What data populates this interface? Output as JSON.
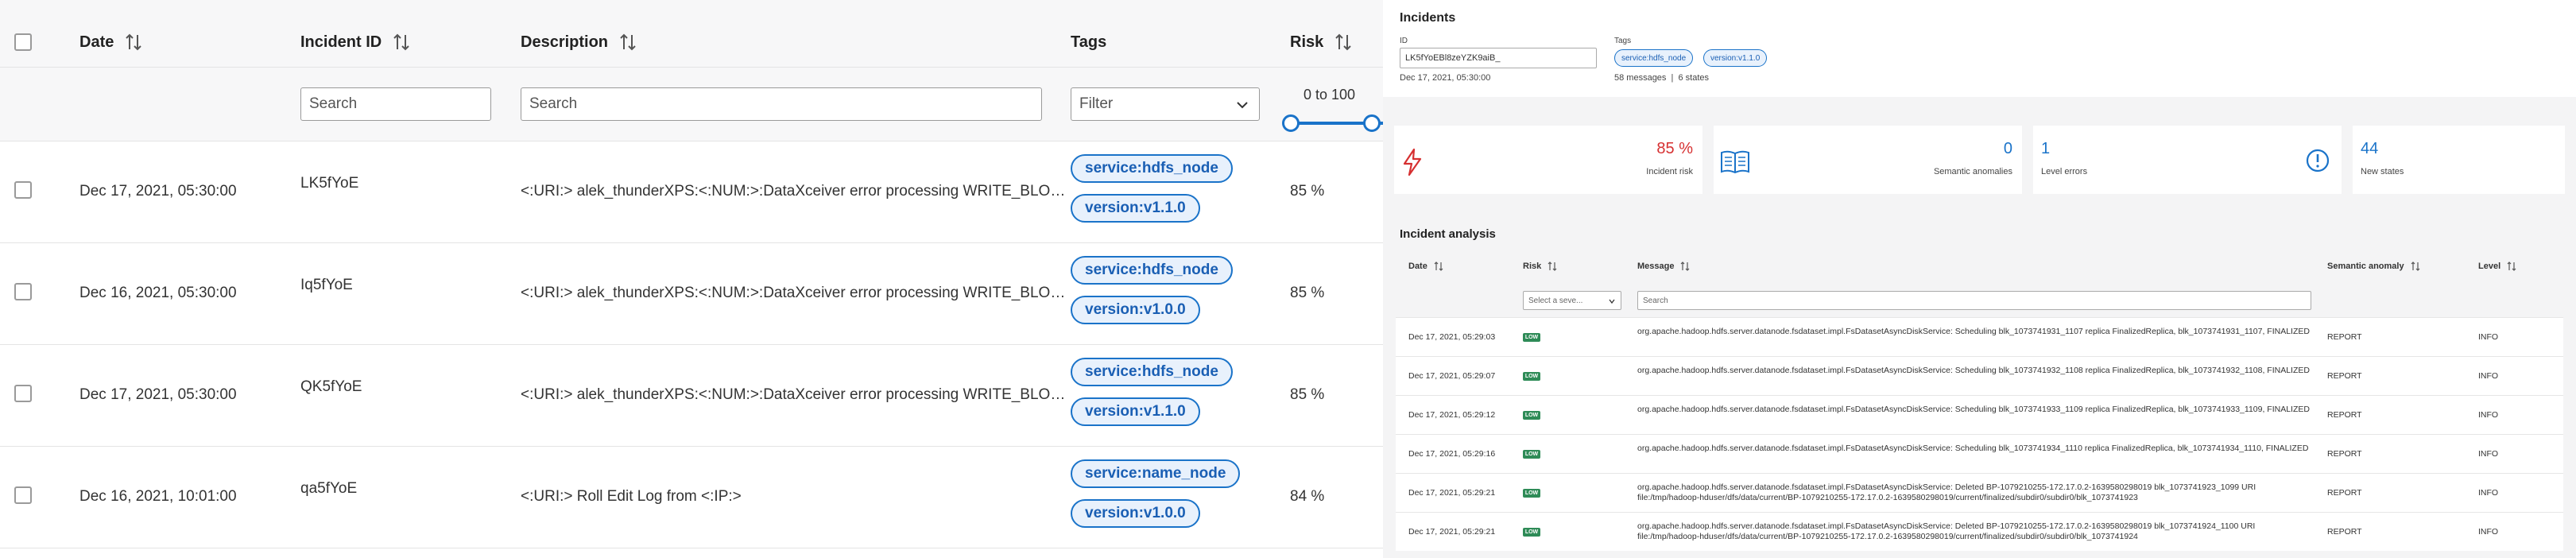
{
  "incidents_table": {
    "columns": {
      "date": "Date",
      "incident_id": "Incident ID",
      "description": "Description",
      "tags": "Tags",
      "risk": "Risk"
    },
    "filters": {
      "incident_id_placeholder": "Search",
      "description_placeholder": "Search",
      "tags_placeholder": "Filter",
      "risk_range_label": "0 to 100",
      "risk_range": [
        0,
        100
      ]
    },
    "rows": [
      {
        "date": "Dec 17, 2021, 05:30:00",
        "id": "LK5fYoE",
        "description": "<:URI:> alek_thunderXPS:<:NUM:>:DataXceiver error processing WRITE_BLO…",
        "tags": [
          "service:hdfs_node",
          "version:v1.1.0"
        ],
        "risk": "85 %"
      },
      {
        "date": "Dec 16, 2021, 05:30:00",
        "id": "Iq5fYoE",
        "description": "<:URI:> alek_thunderXPS:<:NUM:>:DataXceiver error processing WRITE_BLO…",
        "tags": [
          "service:hdfs_node",
          "version:v1.0.0"
        ],
        "risk": "85 %"
      },
      {
        "date": "Dec 17, 2021, 05:30:00",
        "id": "QK5fYoE",
        "description": "<:URI:> alek_thunderXPS:<:NUM:>:DataXceiver error processing WRITE_BLO…",
        "tags": [
          "service:hdfs_node",
          "version:v1.1.0"
        ],
        "risk": "85 %"
      },
      {
        "date": "Dec 16, 2021, 10:01:00",
        "id": "qa5fYoE",
        "description": "<:URI:> Roll Edit Log from <:IP:>",
        "tags": [
          "service:name_node",
          "version:v1.0.0"
        ],
        "risk": "84 %"
      }
    ]
  },
  "incident_detail": {
    "title": "Incidents",
    "id_label": "ID",
    "id_value": "LK5fYoEBl8zeYZK9aiB_",
    "date": "Dec 17, 2021, 05:30:00",
    "tags_label": "Tags",
    "tags": [
      "service:hdfs_node",
      "version:v1.1.0"
    ],
    "summary": "58 messages  |  6 states"
  },
  "stats": {
    "incident_risk": {
      "value": "85 %",
      "label": "Incident risk",
      "color": "#d63031"
    },
    "semantic_anomalies": {
      "value": "0",
      "label": "Semantic anomalies",
      "color": "#1a73c9"
    },
    "level_errors": {
      "value": "1",
      "label": "Level errors",
      "color": "#1a73c9"
    },
    "new_states": {
      "value": "44",
      "label": "New states",
      "color": "#1a73c9"
    }
  },
  "analysis": {
    "title": "Incident analysis",
    "columns": {
      "date": "Date",
      "risk": "Risk",
      "message": "Message",
      "semantic_anomaly": "Semantic anomaly",
      "level": "Level"
    },
    "risk_select_placeholder": "Select a seve...",
    "message_search_placeholder": "Search",
    "rows": [
      {
        "date": "Dec 17, 2021, 05:29:03",
        "risk": "LOW",
        "message": "org.apache.hadoop.hdfs.server.datanode.fsdataset.impl.FsDatasetAsyncDiskService: Scheduling blk_1073741931_1107 replica FinalizedReplica, blk_1073741931_1107, FINALIZED",
        "anomaly": "REPORT",
        "level": "INFO"
      },
      {
        "date": "Dec 17, 2021, 05:29:07",
        "risk": "LOW",
        "message": "org.apache.hadoop.hdfs.server.datanode.fsdataset.impl.FsDatasetAsyncDiskService: Scheduling blk_1073741932_1108 replica FinalizedReplica, blk_1073741932_1108, FINALIZED",
        "anomaly": "REPORT",
        "level": "INFO"
      },
      {
        "date": "Dec 17, 2021, 05:29:12",
        "risk": "LOW",
        "message": "org.apache.hadoop.hdfs.server.datanode.fsdataset.impl.FsDatasetAsyncDiskService: Scheduling blk_1073741933_1109 replica FinalizedReplica, blk_1073741933_1109, FINALIZED",
        "anomaly": "REPORT",
        "level": "INFO"
      },
      {
        "date": "Dec 17, 2021, 05:29:16",
        "risk": "LOW",
        "message": "org.apache.hadoop.hdfs.server.datanode.fsdataset.impl.FsDatasetAsyncDiskService: Scheduling blk_1073741934_1110 replica FinalizedReplica, blk_1073741934_1110, FINALIZED",
        "anomaly": "REPORT",
        "level": "INFO"
      },
      {
        "date": "Dec 17, 2021, 05:29:21",
        "risk": "LOW",
        "message": "org.apache.hadoop.hdfs.server.datanode.fsdataset.impl.FsDatasetAsyncDiskService: Deleted BP-1079210255-172.17.0.2-1639580298019 blk_1073741923_1099 URI file:/tmp/hadoop-hduser/dfs/data/current/BP-1079210255-172.17.0.2-1639580298019/current/finalized/subdir0/subdir0/blk_1073741923",
        "anomaly": "REPORT",
        "level": "INFO"
      },
      {
        "date": "Dec 17, 2021, 05:29:21",
        "risk": "LOW",
        "message": "org.apache.hadoop.hdfs.server.datanode.fsdataset.impl.FsDatasetAsyncDiskService: Deleted BP-1079210255-172.17.0.2-1639580298019 blk_1073741924_1100 URI file:/tmp/hadoop-hduser/dfs/data/current/BP-1079210255-172.17.0.2-1639580298019/current/finalized/subdir0/subdir0/blk_1073741924",
        "anomaly": "REPORT",
        "level": "INFO"
      }
    ]
  }
}
